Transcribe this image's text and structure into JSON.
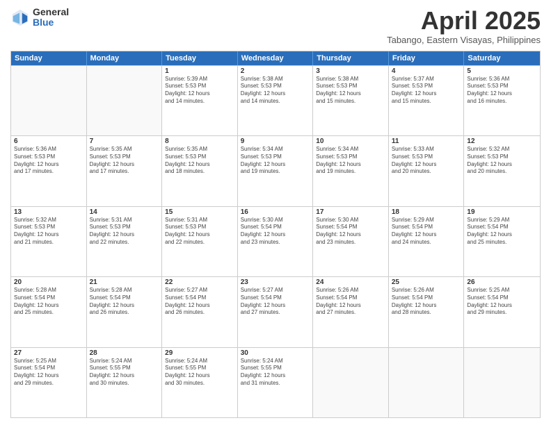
{
  "logo": {
    "general": "General",
    "blue": "Blue"
  },
  "title": "April 2025",
  "location": "Tabango, Eastern Visayas, Philippines",
  "weekdays": [
    "Sunday",
    "Monday",
    "Tuesday",
    "Wednesday",
    "Thursday",
    "Friday",
    "Saturday"
  ],
  "weeks": [
    [
      {
        "day": "",
        "info": ""
      },
      {
        "day": "",
        "info": ""
      },
      {
        "day": "1",
        "info": "Sunrise: 5:39 AM\nSunset: 5:53 PM\nDaylight: 12 hours\nand 14 minutes."
      },
      {
        "day": "2",
        "info": "Sunrise: 5:38 AM\nSunset: 5:53 PM\nDaylight: 12 hours\nand 14 minutes."
      },
      {
        "day": "3",
        "info": "Sunrise: 5:38 AM\nSunset: 5:53 PM\nDaylight: 12 hours\nand 15 minutes."
      },
      {
        "day": "4",
        "info": "Sunrise: 5:37 AM\nSunset: 5:53 PM\nDaylight: 12 hours\nand 15 minutes."
      },
      {
        "day": "5",
        "info": "Sunrise: 5:36 AM\nSunset: 5:53 PM\nDaylight: 12 hours\nand 16 minutes."
      }
    ],
    [
      {
        "day": "6",
        "info": "Sunrise: 5:36 AM\nSunset: 5:53 PM\nDaylight: 12 hours\nand 17 minutes."
      },
      {
        "day": "7",
        "info": "Sunrise: 5:35 AM\nSunset: 5:53 PM\nDaylight: 12 hours\nand 17 minutes."
      },
      {
        "day": "8",
        "info": "Sunrise: 5:35 AM\nSunset: 5:53 PM\nDaylight: 12 hours\nand 18 minutes."
      },
      {
        "day": "9",
        "info": "Sunrise: 5:34 AM\nSunset: 5:53 PM\nDaylight: 12 hours\nand 19 minutes."
      },
      {
        "day": "10",
        "info": "Sunrise: 5:34 AM\nSunset: 5:53 PM\nDaylight: 12 hours\nand 19 minutes."
      },
      {
        "day": "11",
        "info": "Sunrise: 5:33 AM\nSunset: 5:53 PM\nDaylight: 12 hours\nand 20 minutes."
      },
      {
        "day": "12",
        "info": "Sunrise: 5:32 AM\nSunset: 5:53 PM\nDaylight: 12 hours\nand 20 minutes."
      }
    ],
    [
      {
        "day": "13",
        "info": "Sunrise: 5:32 AM\nSunset: 5:53 PM\nDaylight: 12 hours\nand 21 minutes."
      },
      {
        "day": "14",
        "info": "Sunrise: 5:31 AM\nSunset: 5:53 PM\nDaylight: 12 hours\nand 22 minutes."
      },
      {
        "day": "15",
        "info": "Sunrise: 5:31 AM\nSunset: 5:53 PM\nDaylight: 12 hours\nand 22 minutes."
      },
      {
        "day": "16",
        "info": "Sunrise: 5:30 AM\nSunset: 5:54 PM\nDaylight: 12 hours\nand 23 minutes."
      },
      {
        "day": "17",
        "info": "Sunrise: 5:30 AM\nSunset: 5:54 PM\nDaylight: 12 hours\nand 23 minutes."
      },
      {
        "day": "18",
        "info": "Sunrise: 5:29 AM\nSunset: 5:54 PM\nDaylight: 12 hours\nand 24 minutes."
      },
      {
        "day": "19",
        "info": "Sunrise: 5:29 AM\nSunset: 5:54 PM\nDaylight: 12 hours\nand 25 minutes."
      }
    ],
    [
      {
        "day": "20",
        "info": "Sunrise: 5:28 AM\nSunset: 5:54 PM\nDaylight: 12 hours\nand 25 minutes."
      },
      {
        "day": "21",
        "info": "Sunrise: 5:28 AM\nSunset: 5:54 PM\nDaylight: 12 hours\nand 26 minutes."
      },
      {
        "day": "22",
        "info": "Sunrise: 5:27 AM\nSunset: 5:54 PM\nDaylight: 12 hours\nand 26 minutes."
      },
      {
        "day": "23",
        "info": "Sunrise: 5:27 AM\nSunset: 5:54 PM\nDaylight: 12 hours\nand 27 minutes."
      },
      {
        "day": "24",
        "info": "Sunrise: 5:26 AM\nSunset: 5:54 PM\nDaylight: 12 hours\nand 27 minutes."
      },
      {
        "day": "25",
        "info": "Sunrise: 5:26 AM\nSunset: 5:54 PM\nDaylight: 12 hours\nand 28 minutes."
      },
      {
        "day": "26",
        "info": "Sunrise: 5:25 AM\nSunset: 5:54 PM\nDaylight: 12 hours\nand 29 minutes."
      }
    ],
    [
      {
        "day": "27",
        "info": "Sunrise: 5:25 AM\nSunset: 5:54 PM\nDaylight: 12 hours\nand 29 minutes."
      },
      {
        "day": "28",
        "info": "Sunrise: 5:24 AM\nSunset: 5:55 PM\nDaylight: 12 hours\nand 30 minutes."
      },
      {
        "day": "29",
        "info": "Sunrise: 5:24 AM\nSunset: 5:55 PM\nDaylight: 12 hours\nand 30 minutes."
      },
      {
        "day": "30",
        "info": "Sunrise: 5:24 AM\nSunset: 5:55 PM\nDaylight: 12 hours\nand 31 minutes."
      },
      {
        "day": "",
        "info": ""
      },
      {
        "day": "",
        "info": ""
      },
      {
        "day": "",
        "info": ""
      }
    ]
  ]
}
